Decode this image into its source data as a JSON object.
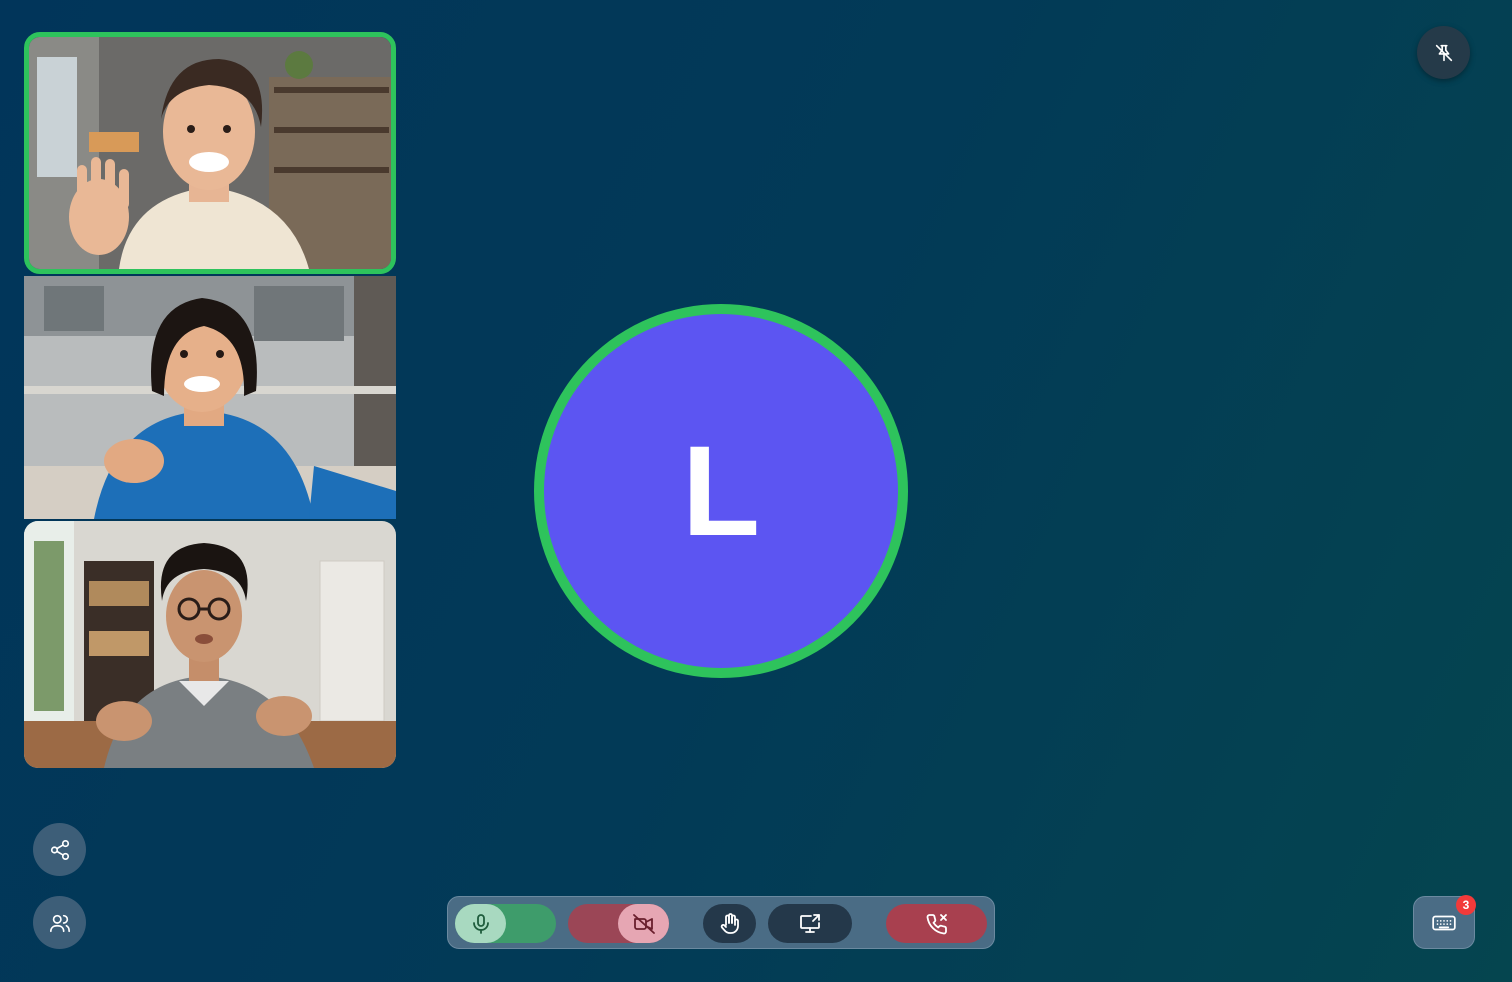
{
  "participants": [
    {
      "id": "participant-1",
      "active_speaker": true,
      "video": "woman-waving-living-room"
    },
    {
      "id": "participant-2",
      "active_speaker": false,
      "video": "woman-blue-sweater-kitchen"
    },
    {
      "id": "participant-3",
      "active_speaker": false,
      "video": "man-glasses-headset-home-office"
    }
  ],
  "speaker": {
    "initial": "L",
    "avatar_color": "#5c55f2",
    "ring_color": "#2ec35c"
  },
  "controls": {
    "mic": {
      "state": "on",
      "icon": "mic-icon",
      "color": "#3e9c6b"
    },
    "camera": {
      "state": "off",
      "icon": "video-off-icon",
      "color": "#9b4656"
    },
    "raise_hand": {
      "icon": "hand-icon"
    },
    "share_screen": {
      "icon": "screen-share-icon"
    },
    "end_call": {
      "icon": "phone-x-icon",
      "color": "#a8404f"
    }
  },
  "side_buttons": {
    "pin": {
      "icon": "pin-off-icon"
    },
    "share_link": {
      "icon": "share-icon"
    },
    "participants": {
      "icon": "users-icon"
    },
    "keyboard": {
      "icon": "keyboard-icon"
    }
  },
  "badge_count": "3",
  "colors": {
    "background": "#023a57",
    "accent_green": "#2ec35c",
    "danger": "#f23a3a"
  }
}
